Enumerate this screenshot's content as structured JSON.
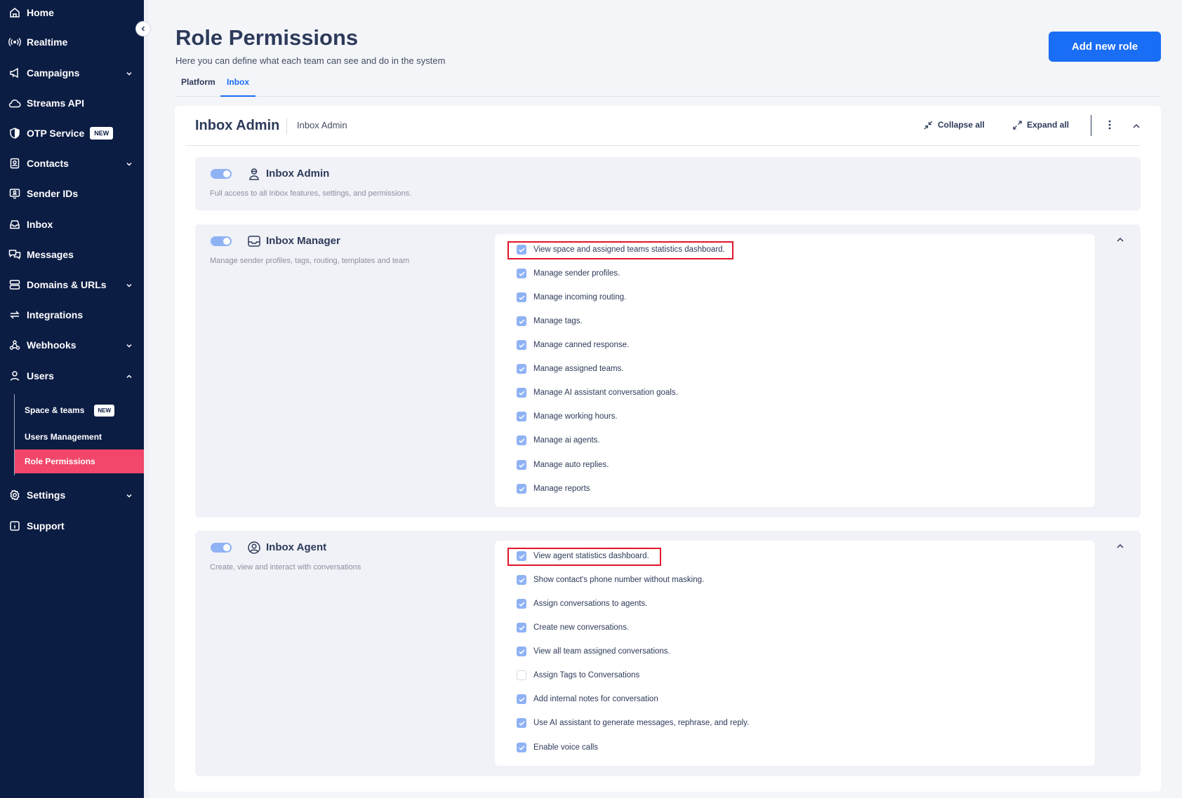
{
  "sidebar": {
    "items": [
      {
        "label": "Home",
        "icon": "home-icon"
      },
      {
        "label": "Realtime",
        "icon": "broadcast-icon"
      },
      {
        "label": "Campaigns",
        "icon": "megaphone-icon"
      },
      {
        "label": "Streams API",
        "icon": "cloud-icon"
      },
      {
        "label": "OTP Service",
        "icon": "shield-icon",
        "badge": "NEW"
      },
      {
        "label": "Contacts",
        "icon": "contacts-icon"
      },
      {
        "label": "Sender IDs",
        "icon": "id-card-icon"
      },
      {
        "label": "Inbox",
        "icon": "inbox-icon"
      },
      {
        "label": "Messages",
        "icon": "chat-icon"
      },
      {
        "label": "Domains & URLs",
        "icon": "server-icon"
      },
      {
        "label": "Integrations",
        "icon": "sync-icon"
      },
      {
        "label": "Webhooks",
        "icon": "webhook-icon"
      },
      {
        "label": "Users",
        "icon": "user-icon"
      },
      {
        "label": "Settings",
        "icon": "gear-icon"
      },
      {
        "label": "Support",
        "icon": "info-icon"
      }
    ],
    "sub_items": [
      {
        "label": "Space & teams",
        "badge": "NEW"
      },
      {
        "label": "Users Management"
      },
      {
        "label": "Role Permissions"
      }
    ]
  },
  "header": {
    "title": "Role Permissions",
    "subtitle": "Here you can define what each team can see and do in the system",
    "add_button": "Add new role",
    "tabs": [
      "Platform",
      "Inbox"
    ],
    "active_tab": "Inbox"
  },
  "card": {
    "title": "Inbox Admin",
    "subtitle": "Inbox Admin",
    "collapse_all": "Collapse all",
    "expand_all": "Expand all"
  },
  "roles": {
    "admin": {
      "name": "Inbox Admin",
      "description": "Full access to all Inbox features, settings, and permissions."
    },
    "manager": {
      "name": "Inbox Manager",
      "description": "Manage sender profiles, tags, routing, templates and team",
      "permissions": [
        {
          "label": "View space and assigned teams statistics dashboard.",
          "checked": true
        },
        {
          "label": "Manage sender profiles.",
          "checked": true
        },
        {
          "label": "Manage incoming routing.",
          "checked": true
        },
        {
          "label": "Manage tags.",
          "checked": true
        },
        {
          "label": "Manage canned response.",
          "checked": true
        },
        {
          "label": "Manage assigned teams.",
          "checked": true
        },
        {
          "label": "Manage AI assistant conversation goals.",
          "checked": true
        },
        {
          "label": "Manage working hours.",
          "checked": true
        },
        {
          "label": "Manage ai agents.",
          "checked": true
        },
        {
          "label": "Manage auto replies.",
          "checked": true
        },
        {
          "label": "Manage reports",
          "checked": true
        }
      ]
    },
    "agent": {
      "name": "Inbox Agent",
      "description": "Create, view and interact with conversations",
      "permissions": [
        {
          "label": "View agent statistics dashboard.",
          "checked": true
        },
        {
          "label": "Show contact's phone number without masking.",
          "checked": true
        },
        {
          "label": "Assign conversations to agents.",
          "checked": true
        },
        {
          "label": "Create new conversations.",
          "checked": true
        },
        {
          "label": "View all team assigned conversations.",
          "checked": true
        },
        {
          "label": "Assign Tags to Conversations",
          "checked": false
        },
        {
          "label": "Add internal notes for conversation",
          "checked": true
        },
        {
          "label": "Use AI assistant to generate messages, rephrase, and reply.",
          "checked": true
        },
        {
          "label": "Enable voice calls",
          "checked": true
        }
      ]
    }
  },
  "colors": {
    "sidebar_bg": "#0c1d44",
    "active_item": "#f2466a",
    "primary": "#1a6df5",
    "checkbox": "#8fb2f5",
    "highlight": "#e0152a"
  }
}
